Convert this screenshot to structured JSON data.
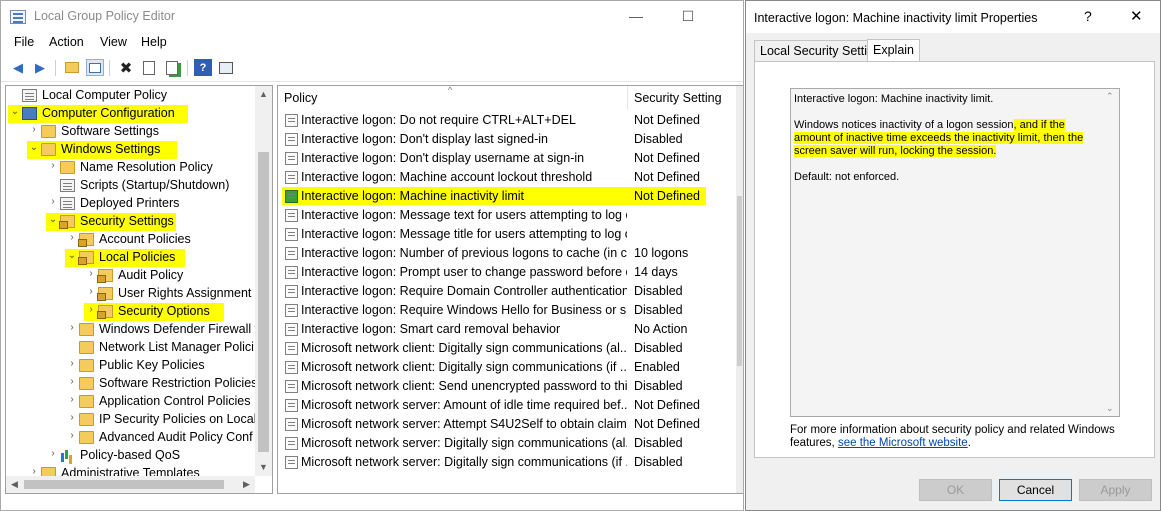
{
  "main_window": {
    "title": "Local Group Policy Editor",
    "controls": {
      "minimize": "—",
      "maximize": "☐"
    }
  },
  "menu": [
    "File",
    "Action",
    "View",
    "Help"
  ],
  "toolbar": {
    "icons": [
      "back-icon",
      "forward-icon",
      "up-folder-icon",
      "show-hide-tree-icon",
      "delete-icon",
      "properties-icon",
      "export-list-icon",
      "help-icon",
      "filter-icon"
    ],
    "glyphs": {
      "back": "◀",
      "forward": "▶",
      "delete": "✖",
      "help": "?"
    }
  },
  "tree": {
    "items": [
      {
        "label": "Local Computer Policy",
        "arrow": "",
        "icon": "document-icon",
        "highlight": false
      },
      {
        "label": "Computer Configuration",
        "arrow": "⌄",
        "icon": "computer-icon",
        "highlight": true
      },
      {
        "label": "Software Settings",
        "arrow": "›",
        "icon": "folder-icon",
        "highlight": false
      },
      {
        "label": "Windows Settings",
        "arrow": "⌄",
        "icon": "folder-icon",
        "highlight": true
      },
      {
        "label": "Name Resolution Policy",
        "arrow": "›",
        "icon": "folder-icon",
        "highlight": false
      },
      {
        "label": "Scripts (Startup/Shutdown)",
        "arrow": "",
        "icon": "document-icon",
        "highlight": false
      },
      {
        "label": "Deployed Printers",
        "arrow": "›",
        "icon": "printer-icon",
        "highlight": false
      },
      {
        "label": "Security Settings",
        "arrow": "⌄",
        "icon": "security-icon",
        "highlight": true
      },
      {
        "label": "Account Policies",
        "arrow": "›",
        "icon": "folder-lock-icon",
        "highlight": false
      },
      {
        "label": "Local Policies",
        "arrow": "⌄",
        "icon": "folder-lock-icon",
        "highlight": true
      },
      {
        "label": "Audit Policy",
        "arrow": "›",
        "icon": "folder-lock-icon",
        "highlight": false
      },
      {
        "label": "User Rights Assignment",
        "arrow": "›",
        "icon": "folder-lock-icon",
        "highlight": false
      },
      {
        "label": "Security Options",
        "arrow": "›",
        "icon": "folder-lock-icon",
        "highlight": true
      },
      {
        "label": "Windows Defender Firewall w",
        "arrow": "›",
        "icon": "folder-icon",
        "highlight": false
      },
      {
        "label": "Network List Manager Polici",
        "arrow": "",
        "icon": "folder-icon",
        "highlight": false
      },
      {
        "label": "Public Key Policies",
        "arrow": "›",
        "icon": "folder-icon",
        "highlight": false
      },
      {
        "label": "Software Restriction Policies",
        "arrow": "›",
        "icon": "folder-icon",
        "highlight": false
      },
      {
        "label": "Application Control Policies",
        "arrow": "›",
        "icon": "folder-icon",
        "highlight": false
      },
      {
        "label": "IP Security Policies on Local",
        "arrow": "›",
        "icon": "folder-icon",
        "highlight": false
      },
      {
        "label": "Advanced Audit Policy Conf",
        "arrow": "›",
        "icon": "folder-icon",
        "highlight": false
      },
      {
        "label": "Policy-based QoS",
        "arrow": "›",
        "icon": "chart-icon",
        "highlight": false
      },
      {
        "label": "Administrative Templates",
        "arrow": "›",
        "icon": "folder-icon",
        "highlight": false
      }
    ],
    "vscroll_position": 0.85
  },
  "list": {
    "columns": {
      "policy": "Policy",
      "setting": "Security Setting"
    },
    "rows": [
      {
        "policy": "Interactive logon: Do not require CTRL+ALT+DEL",
        "setting": "Not Defined",
        "selected": false
      },
      {
        "policy": "Interactive logon: Don't display last signed-in",
        "setting": "Disabled",
        "selected": false
      },
      {
        "policy": "Interactive logon: Don't display username at sign-in",
        "setting": "Not Defined",
        "selected": false
      },
      {
        "policy": "Interactive logon: Machine account lockout threshold",
        "setting": "Not Defined",
        "selected": false
      },
      {
        "policy": "Interactive logon: Machine inactivity limit",
        "setting": "Not Defined",
        "selected": true
      },
      {
        "policy": "Interactive logon: Message text for users attempting to log on",
        "setting": "",
        "selected": false
      },
      {
        "policy": "Interactive logon: Message title for users attempting to log on",
        "setting": "",
        "selected": false
      },
      {
        "policy": "Interactive logon: Number of previous logons to cache (in c...",
        "setting": "10 logons",
        "selected": false
      },
      {
        "policy": "Interactive logon: Prompt user to change password before e...",
        "setting": "14 days",
        "selected": false
      },
      {
        "policy": "Interactive logon: Require Domain Controller authentication...",
        "setting": "Disabled",
        "selected": false
      },
      {
        "policy": "Interactive logon: Require Windows Hello for Business or sm...",
        "setting": "Disabled",
        "selected": false
      },
      {
        "policy": "Interactive logon: Smart card removal behavior",
        "setting": "No Action",
        "selected": false
      },
      {
        "policy": "Microsoft network client: Digitally sign communications (al...",
        "setting": "Disabled",
        "selected": false
      },
      {
        "policy": "Microsoft network client: Digitally sign communications (if ...",
        "setting": "Enabled",
        "selected": false
      },
      {
        "policy": "Microsoft network client: Send unencrypted password to thi...",
        "setting": "Disabled",
        "selected": false
      },
      {
        "policy": "Microsoft network server: Amount of idle time required bef...",
        "setting": "Not Defined",
        "selected": false
      },
      {
        "policy": "Microsoft network server: Attempt S4U2Self to obtain claim ...",
        "setting": "Not Defined",
        "selected": false
      },
      {
        "policy": "Microsoft network server: Digitally sign communications (al...",
        "setting": "Disabled",
        "selected": false
      },
      {
        "policy": "Microsoft network server: Digitally sign communications (if ...",
        "setting": "Disabled",
        "selected": false
      }
    ]
  },
  "dialog": {
    "title": "Interactive logon: Machine inactivity limit Properties",
    "help": "?",
    "close": "✕",
    "tabs": [
      "Local Security Setting",
      "Explain"
    ],
    "active_tab": "Explain",
    "explain": {
      "line1": "Interactive logon: Machine inactivity limit.",
      "para2_plain": "Windows notices inactivity of a logon session",
      "para2_highlight": ", and if the amount of inactive time exceeds the inactivity limit, then the screen saver will run, locking the session.",
      "line3": "Default: not enforced."
    },
    "more_info_text": "For more information about security policy and related Windows features, ",
    "more_info_link": "see the Microsoft website",
    "more_info_end": ".",
    "buttons": {
      "ok": "OK",
      "cancel": "Cancel",
      "apply": "Apply"
    }
  },
  "colors": {
    "highlight": "#ffff00",
    "link": "#0645ad",
    "accent": "#0078d7"
  }
}
